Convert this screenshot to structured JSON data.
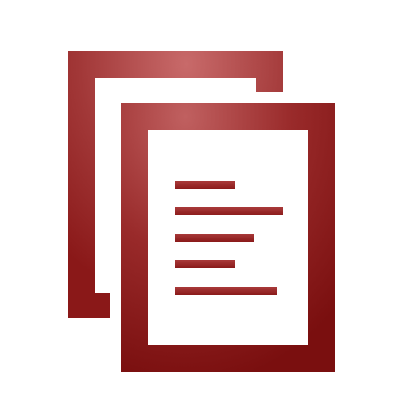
{
  "icon": {
    "name": "copy-documents-icon",
    "colors": {
      "primary": "#8f1c1c",
      "highlight": "#c86a6a",
      "dark": "#7a0f0f",
      "paper": "#ffffff"
    }
  }
}
